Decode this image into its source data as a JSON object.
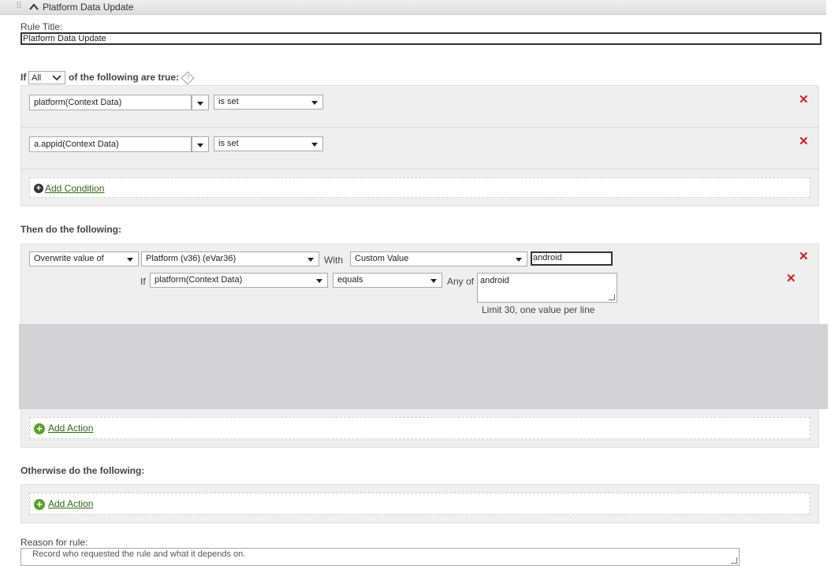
{
  "header": {
    "title": "Platform Data Update",
    "grip_icon": "drag-handle-icon",
    "collapse_icon": "chevron-up-icon"
  },
  "rule_title": {
    "label": "Rule Title:",
    "value": "Platform Data Update"
  },
  "conditions": {
    "prefix": "If",
    "match_value": "All",
    "suffix": "of the following are true:",
    "help_icon": "help-icon",
    "rows": [
      {
        "field": "platform(Context Data)",
        "operator": "is set"
      },
      {
        "field": "a.appid(Context Data)",
        "operator": "is set"
      }
    ],
    "add_label": "Add Condition"
  },
  "actions": {
    "heading": "Then do the following:",
    "action_type": "Overwrite value of",
    "variable": "Platform (v36) (eVar36)",
    "with_label": "With",
    "with_value": "Custom Value",
    "custom_value": "android",
    "sub_condition": {
      "if_label": "If",
      "field": "platform(Context Data)",
      "operator": "equals",
      "any_of_label": "Any of",
      "values": "android",
      "hint": "Limit 30, one value per line"
    },
    "add_label": "Add Action"
  },
  "otherwise": {
    "heading": "Otherwise do the following:",
    "add_label": "Add Action"
  },
  "reason": {
    "label": "Reason for rule:",
    "placeholder": "Record who requested the rule and what it depends on."
  },
  "colors": {
    "remove": "#cc1f1f",
    "link": "#2d6b0f",
    "add_icon": "#5aa02c",
    "panel": "#efefef"
  }
}
